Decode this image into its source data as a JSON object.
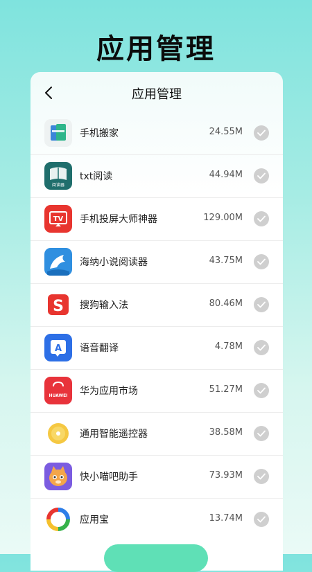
{
  "banner": {
    "title": "应用管理"
  },
  "header": {
    "title": "应用管理",
    "back_icon": "chevron-left-icon"
  },
  "apps": [
    {
      "name": "手机搬家",
      "size": "24.55M",
      "icon": "phone-clone-icon"
    },
    {
      "name": "txt阅读",
      "size": "44.94M",
      "icon": "txt-reader-icon",
      "icon_text": "阅读器"
    },
    {
      "name": "手机投屏大师神器",
      "size": "129.00M",
      "icon": "tv-cast-icon",
      "icon_text": "TV"
    },
    {
      "name": "海纳小说阅读器",
      "size": "43.75M",
      "icon": "dolphin-icon"
    },
    {
      "name": "搜狗输入法",
      "size": "80.46M",
      "icon": "sogou-icon",
      "icon_text": "S"
    },
    {
      "name": "语音翻译",
      "size": "4.78M",
      "icon": "translate-icon",
      "icon_text": "A"
    },
    {
      "name": "华为应用市场",
      "size": "51.27M",
      "icon": "huawei-appgallery-icon",
      "icon_text": "HUAWEI"
    },
    {
      "name": "通用智能遥控器",
      "size": "38.58M",
      "icon": "remote-control-icon"
    },
    {
      "name": "快小喵吧助手",
      "size": "73.93M",
      "icon": "cat-icon"
    },
    {
      "name": "应用宝",
      "size": "13.74M",
      "icon": "yingyongbao-icon"
    }
  ],
  "colors": {
    "check_bg": "#cfcfcf",
    "accent": "#5fe0b6",
    "background_top": "#7fe3de"
  }
}
